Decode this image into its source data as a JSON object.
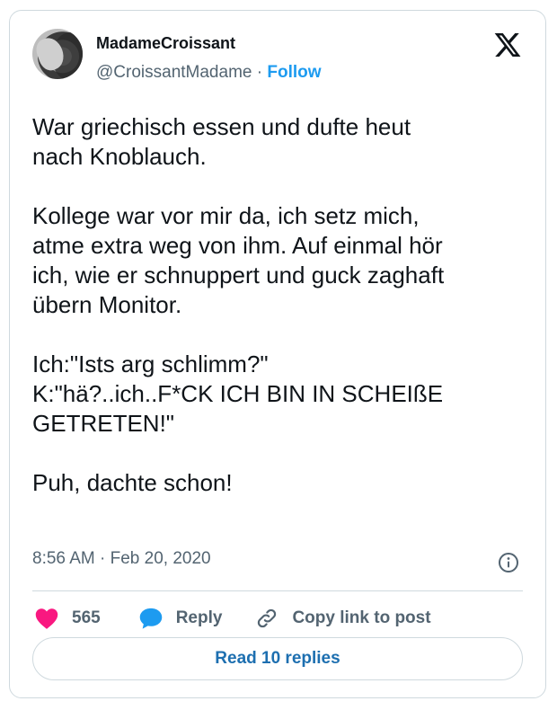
{
  "author": {
    "display_name": "MadameCroissant",
    "handle": "@CroissantMadame",
    "separator": "·",
    "follow_label": "Follow"
  },
  "tweet": {
    "text": "War griechisch essen und dufte heut\nnach Knoblauch.\n\nKollege war vor mir da, ich setz mich,\natme extra weg von ihm. Auf einmal hör\nich, wie er schnuppert und guck zaghaft\nübern Monitor.\n\nIch:\"Ists arg schlimm?\"\nK:\"hä?..ich..F*CK ICH BIN IN SCHEIßE\nGETRETEN!\"\n\nPuh, dachte schon!",
    "time": "8:56 AM",
    "separator": "·",
    "date": "Feb 20, 2020"
  },
  "actions": {
    "like_count": "565",
    "reply_label": "Reply",
    "copy_link_label": "Copy link to post"
  },
  "read_replies_label": "Read 10 replies",
  "icons": {
    "logo": "x-logo-icon",
    "info": "info-icon",
    "like": "heart-icon",
    "reply": "speech-bubble-icon",
    "copy": "link-icon"
  },
  "colors": {
    "accent": "#1d9bf0",
    "like": "#f91880",
    "muted": "#536471",
    "text": "#0f1419",
    "border": "#cfd9de"
  }
}
